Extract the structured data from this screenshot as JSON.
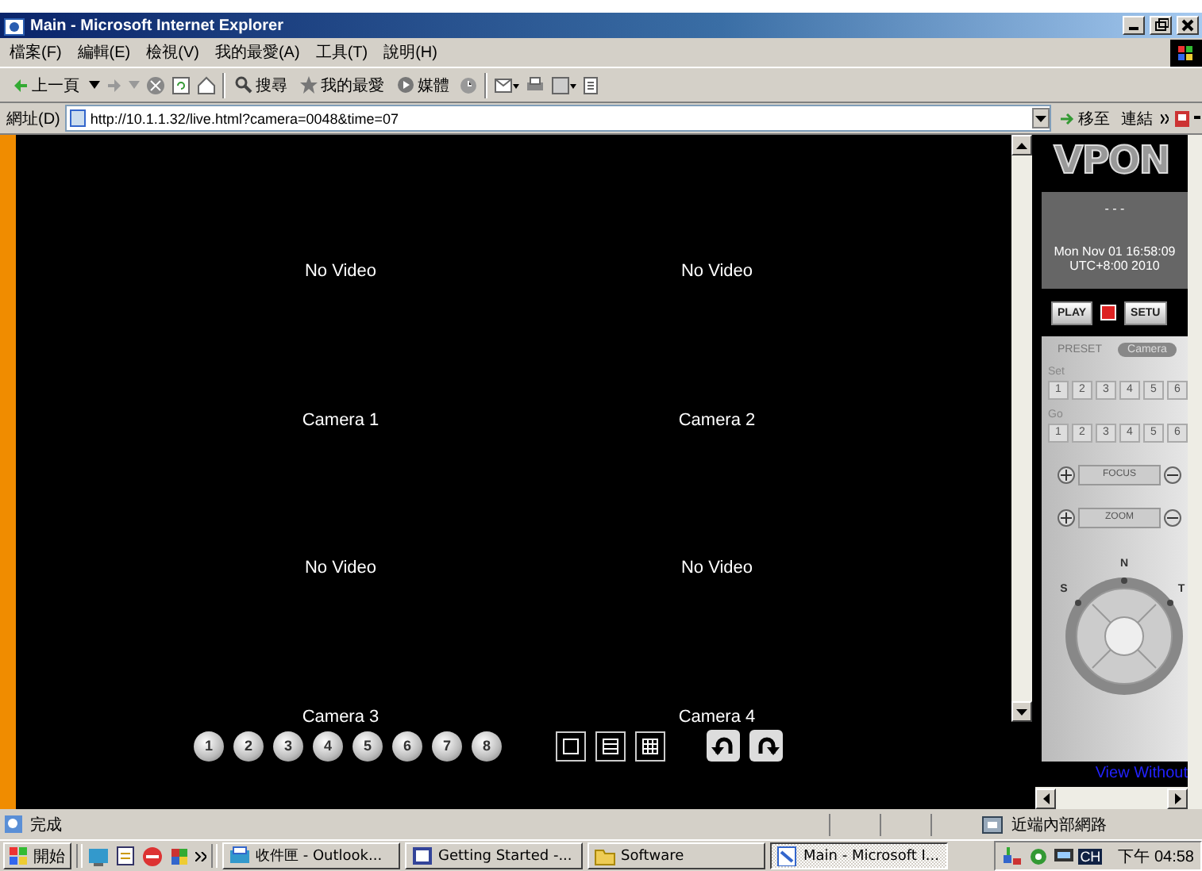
{
  "window": {
    "title": "Main - Microsoft Internet Explorer"
  },
  "menu": [
    "檔案(F)",
    "編輯(E)",
    "檢視(V)",
    "我的最愛(A)",
    "工具(T)",
    "說明(H)"
  ],
  "toolbar": {
    "back": "上一頁",
    "search": "搜尋",
    "favorites": "我的最愛",
    "media": "媒體"
  },
  "address": {
    "label": "網址(D)",
    "value": "http://10.1.1.32/live.html?camera=0048&time=07",
    "go": "移至",
    "links": "連結"
  },
  "video_cells": [
    {
      "message": "No Video",
      "camera": "Camera 1"
    },
    {
      "message": "No Video",
      "camera": "Camera 2"
    },
    {
      "message": "No Video",
      "camera": "Camera 3"
    },
    {
      "message": "No Video",
      "camera": "Camera 4"
    }
  ],
  "channel_buttons": [
    "1",
    "2",
    "3",
    "4",
    "5",
    "6",
    "7",
    "8"
  ],
  "layouts": [
    {
      "kind": "single"
    },
    {
      "kind": "rows"
    },
    {
      "kind": "grid"
    }
  ],
  "rotate": [
    {
      "kind": "ccw"
    },
    {
      "kind": "cw"
    }
  ],
  "panel": {
    "logo": "VPON",
    "status": "- - -",
    "date": "Mon Nov 01 16:58:09",
    "zone": "UTC+8:00 2010",
    "play": "PLAY",
    "setup": "SETU",
    "tabs": [
      {
        "label": "PRESET",
        "selected": false
      },
      {
        "label": "Camera",
        "selected": true
      }
    ],
    "set_label": "Set",
    "set_buttons": [
      "1",
      "2",
      "3",
      "4",
      "5",
      "6"
    ],
    "go_label": "Go",
    "go_buttons": [
      "1",
      "2",
      "3",
      "4",
      "5",
      "6"
    ],
    "focus": "FOCUS",
    "zoom": "ZOOM",
    "compass": [
      "N",
      "S",
      "T"
    ],
    "link": "View Without"
  },
  "status_bar": {
    "text": "完成",
    "zone": "近端內部網路"
  },
  "taskbar": {
    "start": "開始",
    "tasks": [
      {
        "label": "收件匣 - Outlook...",
        "selected": false
      },
      {
        "label": "Getting Started -...",
        "selected": false
      },
      {
        "label": "Software",
        "selected": false
      },
      {
        "label": "Main - Microsoft I...",
        "selected": true
      }
    ],
    "ime": "CH",
    "clock": "下午 04:58"
  }
}
